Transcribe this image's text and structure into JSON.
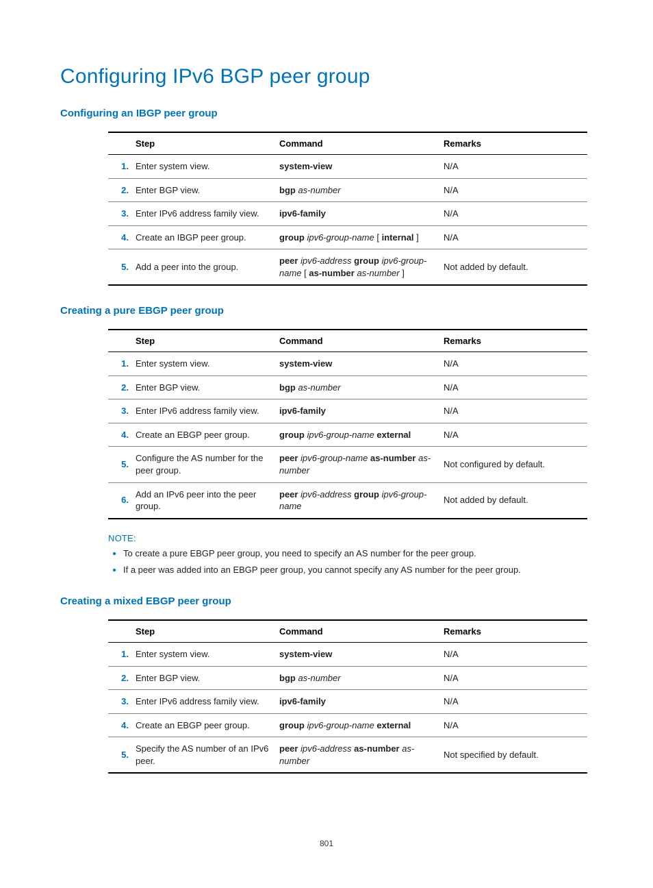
{
  "title": "Configuring IPv6 BGP peer group",
  "sections": [
    {
      "heading": "Configuring an IBGP peer group",
      "headers": {
        "step": "Step",
        "command": "Command",
        "remarks": "Remarks"
      },
      "rows": [
        {
          "n": "1.",
          "step": "Enter system view.",
          "cmd": "<b>system-view</b>",
          "rmk": "N/A"
        },
        {
          "n": "2.",
          "step": "Enter BGP view.",
          "cmd": "<b>bgp</b> <i>as-number</i>",
          "rmk": "N/A"
        },
        {
          "n": "3.",
          "step": "Enter IPv6 address family view.",
          "cmd": "<b>ipv6-family</b>",
          "rmk": "N/A"
        },
        {
          "n": "4.",
          "step": "Create an IBGP peer group.",
          "cmd": "<b>group</b> <i>ipv6-group-name</i> [ <b>internal</b> ]",
          "rmk": "N/A"
        },
        {
          "n": "5.",
          "step": "Add a peer into the group.",
          "cmd": "<b>peer</b> <i>ipv6-address</i> <b>group</b> <i>ipv6-group-name</i> [ <b>as-number</b> <i>as-number</i> ]",
          "rmk": "Not added by default."
        }
      ]
    },
    {
      "heading": "Creating a pure EBGP peer group",
      "headers": {
        "step": "Step",
        "command": "Command",
        "remarks": "Remarks"
      },
      "rows": [
        {
          "n": "1.",
          "step": "Enter system view.",
          "cmd": "<b>system-view</b>",
          "rmk": "N/A"
        },
        {
          "n": "2.",
          "step": "Enter BGP view.",
          "cmd": "<b>bgp</b> <i>as-number</i>",
          "rmk": "N/A"
        },
        {
          "n": "3.",
          "step": "Enter IPv6 address family view.",
          "cmd": "<b>ipv6-family</b>",
          "rmk": "N/A"
        },
        {
          "n": "4.",
          "step": "Create an EBGP peer group.",
          "cmd": "<b>group</b> <i>ipv6-group-name</i> <b>external</b>",
          "rmk": "N/A"
        },
        {
          "n": "5.",
          "step": "Configure the AS number for the peer group.",
          "cmd": "<b>peer</b> <i>ipv6-group-name</i> <b>as-number</b> <i>as-number</i>",
          "rmk": "Not configured by default."
        },
        {
          "n": "6.",
          "step": "Add an IPv6 peer into the peer group.",
          "cmd": "<b>peer</b> <i>ipv6-address</i> <b>group</b> <i>ipv6-group-name</i>",
          "rmk": "Not added by default."
        }
      ],
      "note_label": "NOTE:",
      "notes": [
        "To create a pure EBGP peer group, you need to specify an AS number for the peer group.",
        "If a peer was added into an EBGP peer group, you cannot specify any AS number for the peer group."
      ]
    },
    {
      "heading": "Creating a mixed EBGP peer group",
      "headers": {
        "step": "Step",
        "command": "Command",
        "remarks": "Remarks"
      },
      "rows": [
        {
          "n": "1.",
          "step": "Enter system view.",
          "cmd": "<b>system-view</b>",
          "rmk": "N/A"
        },
        {
          "n": "2.",
          "step": "Enter BGP view.",
          "cmd": "<b>bgp</b> <i>as-number</i>",
          "rmk": "N/A"
        },
        {
          "n": "3.",
          "step": "Enter IPv6 address family view.",
          "cmd": "<b>ipv6-family</b>",
          "rmk": "N/A"
        },
        {
          "n": "4.",
          "step": "Create an EBGP peer group.",
          "cmd": "<b>group</b> <i>ipv6-group-name</i> <b>external</b>",
          "rmk": "N/A"
        },
        {
          "n": "5.",
          "step": "Specify the AS number of an IPv6 peer.",
          "cmd": "<b>peer</b> <i>ipv6-address</i> <b>as-number</b> <i>as-number</i>",
          "rmk": "Not specified by default."
        }
      ]
    }
  ],
  "page_number": "801"
}
